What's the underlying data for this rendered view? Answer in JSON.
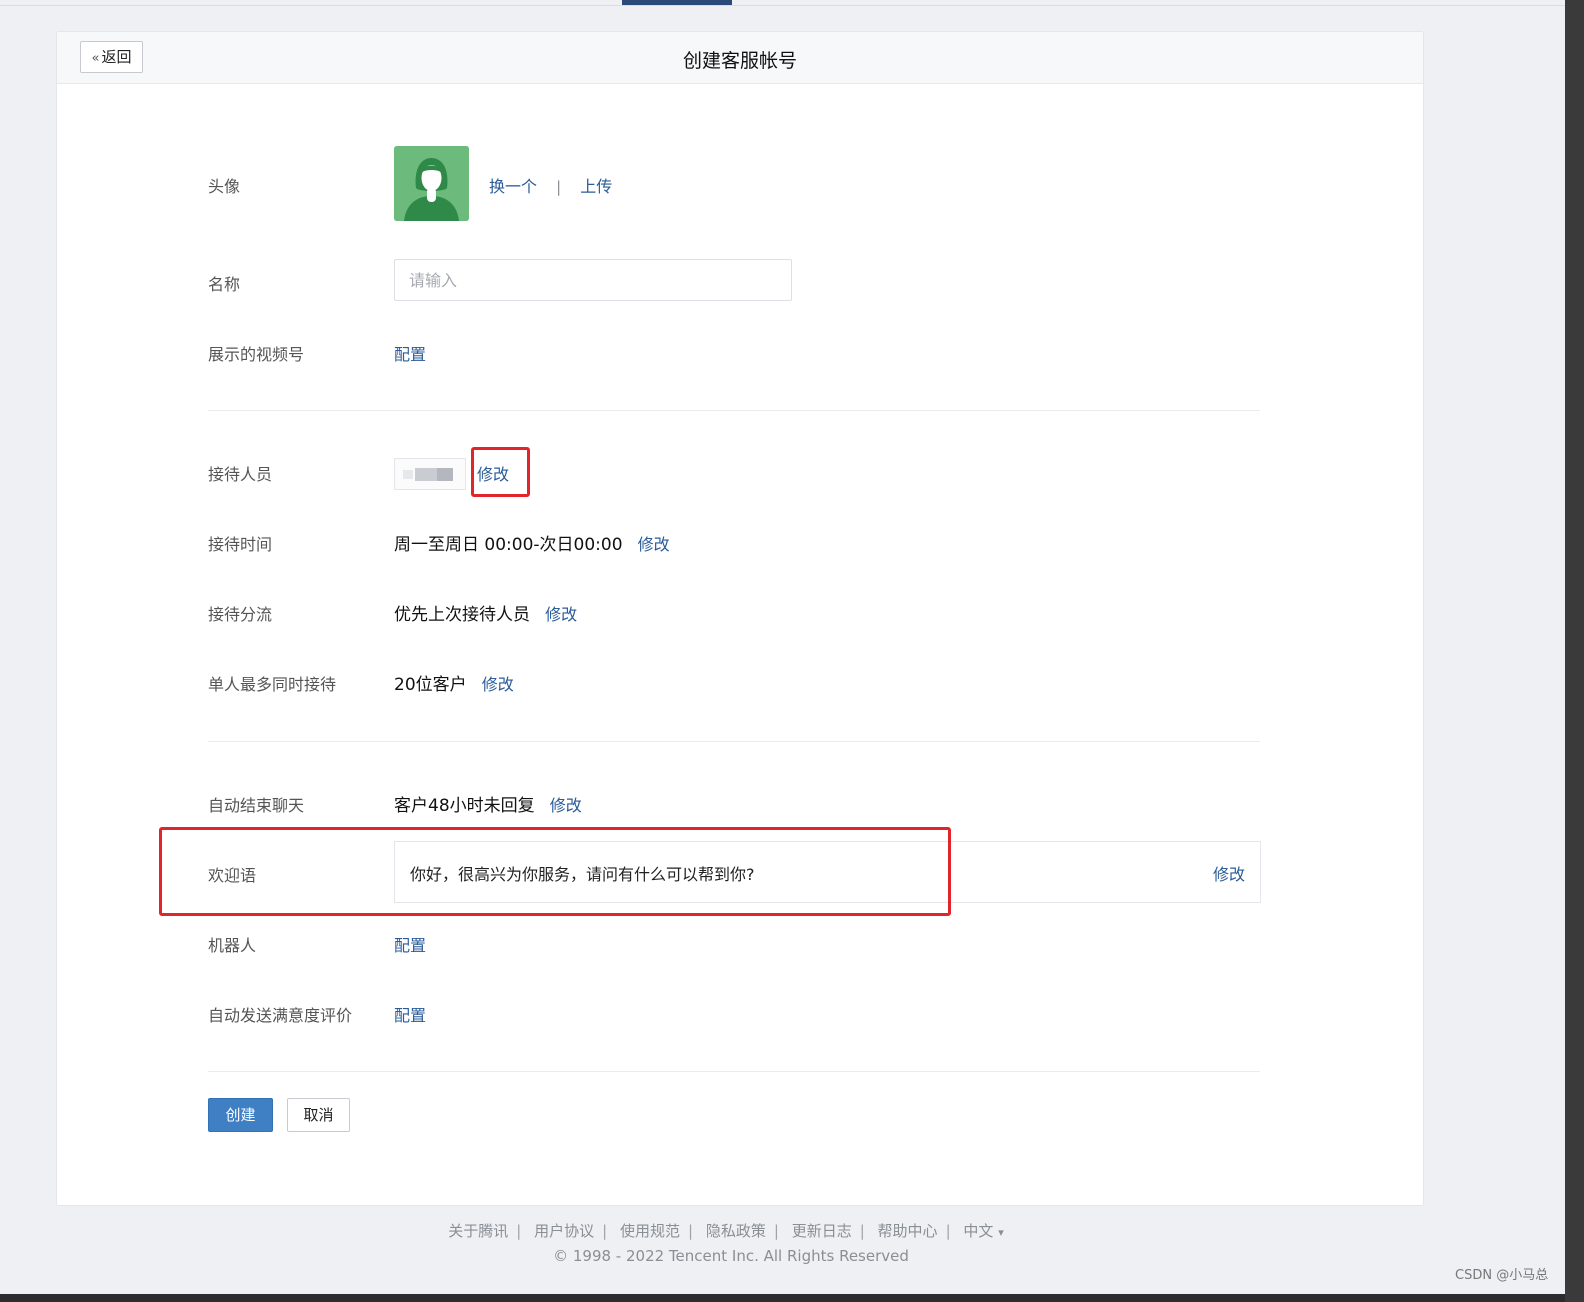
{
  "header": {
    "back_label": "返回",
    "back_icon": "chevrons-left-icon",
    "title": "创建客服帐号"
  },
  "avatar_row": {
    "label": "头像",
    "change_link": "换一个",
    "separator": "|",
    "upload_link": "上传",
    "avatar_icon": "person-avatar-icon",
    "avatar_bg": "#6dbb7c"
  },
  "name_row": {
    "label": "名称",
    "placeholder": "请输入",
    "value": ""
  },
  "video_row": {
    "label": "展示的视频号",
    "link": "配置"
  },
  "staff_row": {
    "label": "接待人员",
    "edit": "修改"
  },
  "time_row": {
    "label": "接待时间",
    "value": "周一至周日 00:00-次日00:00",
    "edit": "修改"
  },
  "route_row": {
    "label": "接待分流",
    "value": "优先上次接待人员",
    "edit": "修改"
  },
  "max_row": {
    "label": "单人最多同时接待",
    "value": "20位客户",
    "edit": "修改"
  },
  "autoend_row": {
    "label": "自动结束聊天",
    "value": "客户48小时未回复",
    "edit": "修改"
  },
  "welcome_row": {
    "label": "欢迎语",
    "value": "你好，很高兴为你服务，请问有什么可以帮到你?",
    "edit": "修改"
  },
  "robot_row": {
    "label": "机器人",
    "link": "配置"
  },
  "survey_row": {
    "label": "自动发送满意度评价",
    "link": "配置"
  },
  "actions": {
    "create": "创建",
    "cancel": "取消"
  },
  "footer": {
    "links": [
      "关于腾讯",
      "用户协议",
      "使用规范",
      "隐私政策",
      "更新日志",
      "帮助中心"
    ],
    "language": "中文",
    "language_arrow": "▾",
    "copyright": "© 1998 - 2022 Tencent Inc. All Rights Reserved"
  },
  "watermark": "CSDN @小马总",
  "colors": {
    "link": "#2b5b98",
    "primary": "#3f7fc4",
    "highlight": "#e0262a"
  }
}
